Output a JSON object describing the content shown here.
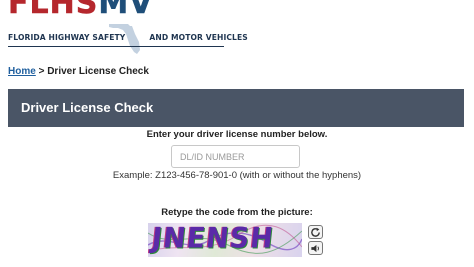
{
  "logo": {
    "wordmark_red": "FLHS",
    "wordmark_dark": "MV",
    "sub_left": "FLORIDA HIGHWAY SAFETY",
    "sub_right": "AND MOTOR VEHICLES"
  },
  "breadcrumb": {
    "home": "Home",
    "separator": " > ",
    "current": "Driver License Check"
  },
  "header": {
    "title": "Driver License Check"
  },
  "form": {
    "instruction": "Enter your driver license number below.",
    "dl_placeholder": "DL/ID NUMBER",
    "dl_value": "",
    "example": "Example: Z123-456-78-901-0 (with or without the hyphens)",
    "captcha_instruction": "Retype the code from the picture:",
    "captcha_code": "JNENSH"
  },
  "icons": {
    "refresh": "refresh-icon",
    "audio": "audio-icon",
    "florida": "florida-map-icon"
  },
  "colors": {
    "brand_red": "#b5272d",
    "brand_navy": "#1f4e79",
    "title_bar": "#4a5566",
    "link": "#1f5f9e"
  }
}
